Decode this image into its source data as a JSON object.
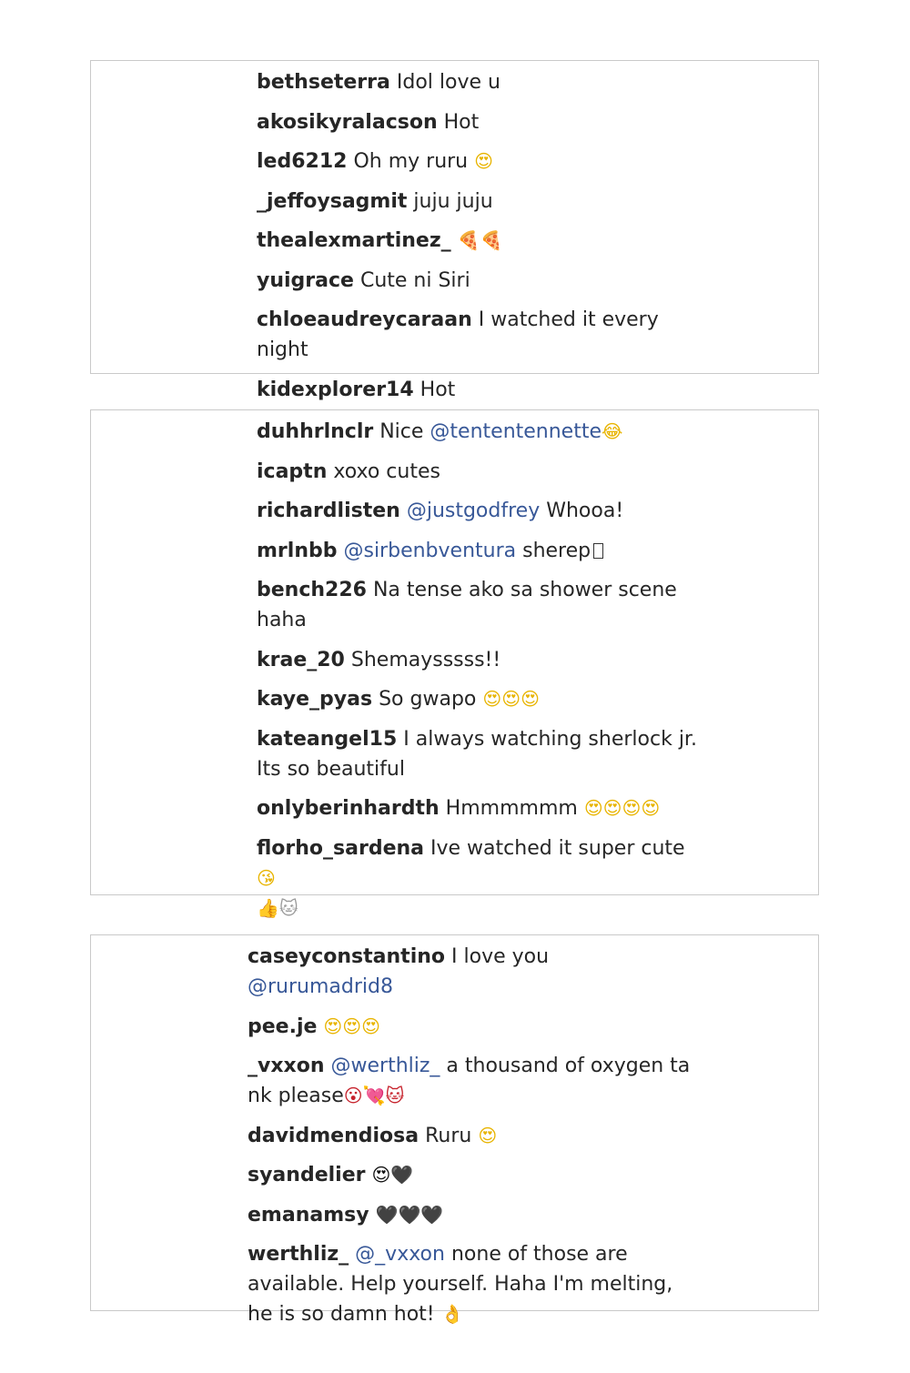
{
  "panels": [
    {
      "comments": [
        {
          "user": "bethseterra",
          "text": "Idol love u"
        },
        {
          "user": "akosikyralacson",
          "text": "Hot"
        },
        {
          "user": "led6212",
          "text": "Oh my ruru",
          "emoji": "😍"
        },
        {
          "user": "_jeffoysagmit",
          "text": "juju juju"
        },
        {
          "user": "thealexmartinez_",
          "emoji": "🍕🍕"
        },
        {
          "user": "yuigrace",
          "text": "Cute ni Siri"
        },
        {
          "user": "chloeaudreycaraan",
          "text": "I watched it every night"
        },
        {
          "user": "kidexplorer14",
          "text": "Hot"
        }
      ]
    },
    {
      "comments": [
        {
          "user": "duhhrlnclr",
          "text": "Nice",
          "mention": "@tententennette",
          "emoji": "😂"
        },
        {
          "user": "icaptn",
          "text": "xoxo cutes"
        },
        {
          "user": "richardlisten",
          "mention": "@justgodfrey",
          "text_after": "Whooa!"
        },
        {
          "user": "mrlnbb",
          "mention": "@sirbenbventura",
          "text_after": "sherep"
        },
        {
          "user": "bench226",
          "text": "Na tense ako sa shower scene haha"
        },
        {
          "user": "krae_20",
          "text": "Shemaysssss!!"
        },
        {
          "user": "kaye_pyas",
          "text": "So gwapo",
          "emoji": "😍😍😍"
        },
        {
          "user": "kateangel15",
          "text": "I always watching sherlock jr. Its so beautiful"
        },
        {
          "user": "onlyberinhardth",
          "text": "Hmmmmmm",
          "emoji": "😍😍😍😍"
        },
        {
          "user": "florho_sardena",
          "text": "Ive watched it super cute",
          "emoji": "😘",
          "emoji2": "👍🐱"
        }
      ]
    },
    {
      "comments": [
        {
          "user": "caseyconstantino",
          "text": "I love you",
          "mention": "@rurumadrid8"
        },
        {
          "user": "pee.je",
          "emoji": "😍😍😍"
        },
        {
          "user": "_vxxon",
          "mention": "@werthliz_",
          "text_after": "a thousand of oxygen ta nk please",
          "emoji": "😮💘🐱"
        },
        {
          "user": "davidmendiosa",
          "text": "Ruru",
          "emoji": "😍"
        },
        {
          "user": "syandelier",
          "emoji": "😍🖤"
        },
        {
          "user": "emanamsy",
          "emoji": "🖤🖤🖤"
        },
        {
          "user": "werthliz_",
          "mention": "@_vxxon",
          "text_after": "none of those are available. Help yourself. Haha I'm melting, he is so damn hot!",
          "emoji": "👌"
        }
      ]
    }
  ]
}
